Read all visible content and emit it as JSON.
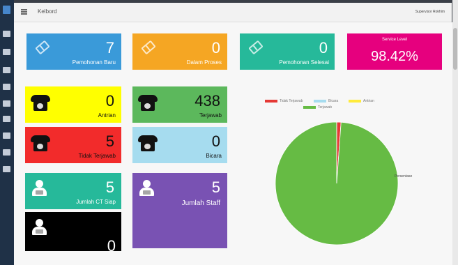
{
  "app": {
    "title": "Kelbord",
    "user": "Supervisor Rokhim"
  },
  "tiles": {
    "permohonan_baru": {
      "value": "7",
      "label": "Pemohonan Baru",
      "color": "#3a9ad9"
    },
    "masih_proses": {
      "value": "0",
      "label": "Dalam Proses",
      "color": "#f5a623"
    },
    "selesai": {
      "value": "0",
      "label": "Pemohonan Selesai",
      "color": "#26b99a"
    },
    "service_level": {
      "value": "98.42%",
      "label": "Service Level",
      "color": "#e6007e"
    },
    "antrian": {
      "value": "0",
      "label": "Antrian",
      "color": "#ffff00"
    },
    "terjawab": {
      "value": "438",
      "label": "Terjawab",
      "color": "#5cb85c"
    },
    "tidak_terjawab": {
      "value": "5",
      "label": "Tidak Terjawab",
      "color": "#f22b2b"
    },
    "bicara": {
      "value": "0",
      "label": "Bicara",
      "color": "#a6dcef"
    },
    "ct_siap": {
      "value": "5",
      "label": "Jumlah CT Siap",
      "color": "#26b99a"
    },
    "staff": {
      "value": "5",
      "label": "Jumlah Staff",
      "color": "#7952b3"
    },
    "istirahat": {
      "value": "0",
      "label": "",
      "color": "#000000"
    }
  },
  "chart_data": {
    "type": "pie",
    "legend": [
      "Tidak Terjawab",
      "Bicara",
      "Antrian",
      "Terjawab"
    ],
    "legend_colors": [
      "#e53935",
      "#a6dcef",
      "#ffeb3b",
      "#66bb44"
    ],
    "values": [
      5,
      0,
      0,
      438
    ],
    "slice_label": "Persentase",
    "legend_position": "top"
  }
}
